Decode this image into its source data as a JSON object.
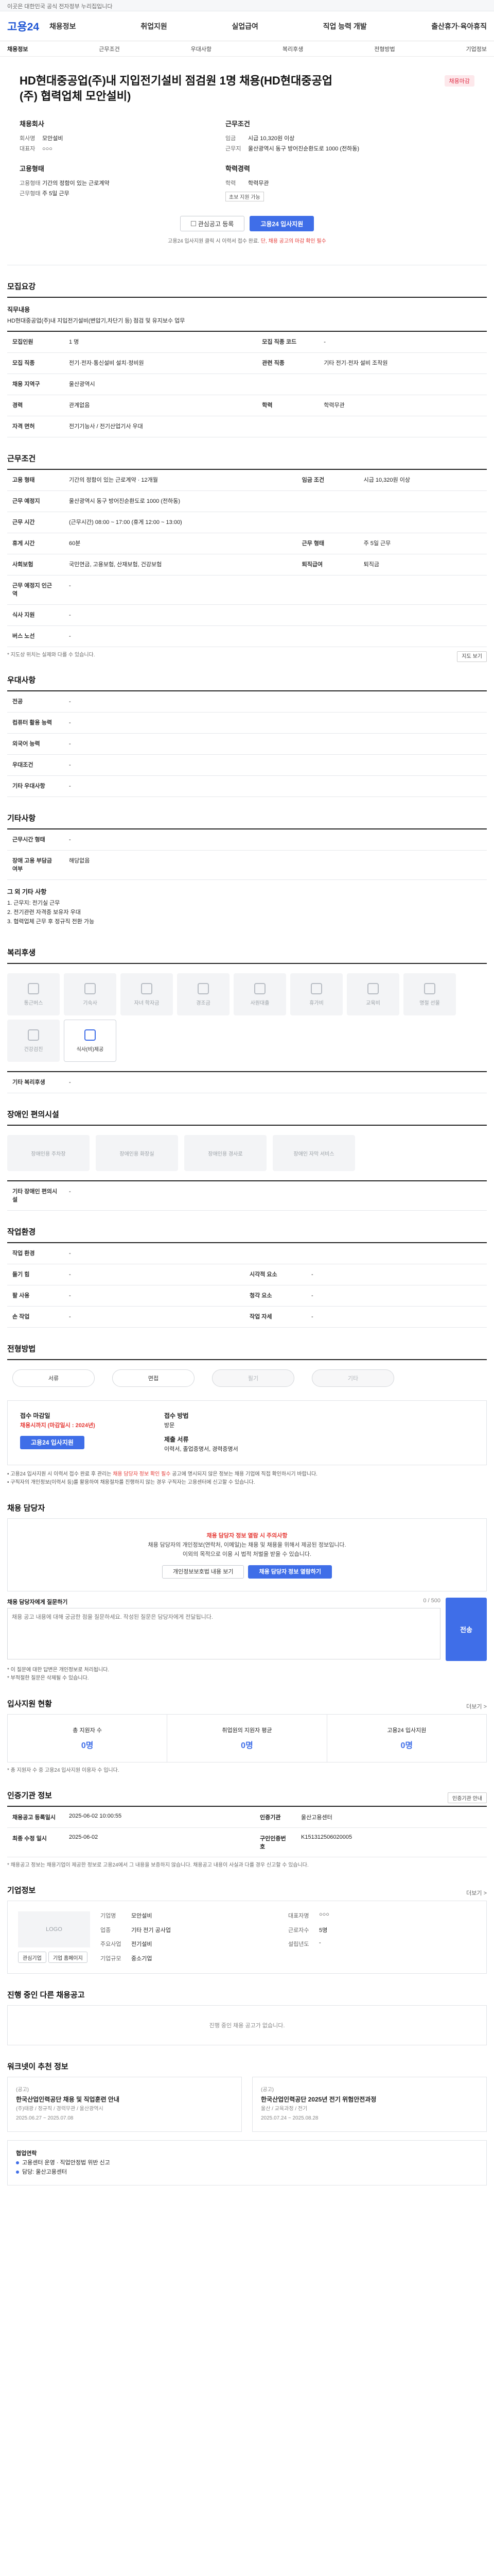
{
  "topbar": {
    "text": "이곳은 대한민국 공식 전자정부 누리집입니다"
  },
  "header": {
    "logo": "고용24",
    "nav": [
      "채용정보",
      "취업지원",
      "실업급여",
      "직업 능력 개발",
      "출산휴가·육아휴직"
    ]
  },
  "subbar": {
    "left": "채용정보",
    "items": [
      "근무조건",
      "우대사항",
      "복리후생",
      "전형방법",
      "기업정보"
    ]
  },
  "hero": {
    "badge": "채용마감",
    "title": "HD현대중공업(주)내 지입전기설비 점검원 1명 채용(HD현대중공업(주) 협력업체 모안설비)",
    "company_heading": "채용회사",
    "company_name_label": "회사명",
    "company_name": "모안설비",
    "company_ceo_label": "대표자",
    "company_ceo": "○○○",
    "cond_heading": "근무조건",
    "wage_label": "임금",
    "wage": "시급 10,320원 이상",
    "place_label": "근무지",
    "place": "울산광역시 동구 방어진순환도로 1000 (전하동)",
    "form_heading": "고용형태",
    "form_label": "고용형태",
    "form": "기간의 정함이 있는 근로계약",
    "career_label": "근무형태",
    "career": "주 5일 근무",
    "edu_heading": "학력경력",
    "edu_label": "학력",
    "edu": "학력무관",
    "tags": [
      "초보 지원 가능"
    ],
    "btn_interest": "관심공고 등록",
    "btn_apply": "고용24 입사지원",
    "hint_prefix": "고용24 입사지원 클릭 시 이력서 접수 완료. ",
    "hint_red": "단, 채용 공고의 마감 확인 필수"
  },
  "job": {
    "title": "모집요강",
    "desc_head": "직무내용",
    "desc": "HD현대중공업(주)내 지입전기설비(변압기,차단기 등) 점검 및 유지보수 업무",
    "rows": [
      {
        "k": "모집인원",
        "v": "1 명",
        "k2": "모집 직종 코드",
        "v2": "-"
      },
      {
        "k": "모집 직종",
        "v": "전기·전자·통신설비 설치·정비원",
        "k2": "관련 직종",
        "v2": "기타 전기·전자 설비 조작원"
      },
      {
        "k": "채용 지역구",
        "v": "울산광역시",
        "k2": "",
        "v2": ""
      },
      {
        "k": "경력",
        "v": "관계없음",
        "k2": "학력",
        "v2": "학력무관"
      },
      {
        "k": "자격 면허",
        "v": "전기기능사 / 전기산업기사 우대",
        "k2": "",
        "v2": ""
      }
    ]
  },
  "work": {
    "title": "근무조건",
    "rows": [
      {
        "k": "고용 형태",
        "v": "기간의 정함이 있는 근로계약 · 12개월",
        "k2": "임금 조건",
        "v2": "시급 10,320원 이상"
      },
      {
        "k": "근무 예정지",
        "v": "울산광역시 동구 방어진순환도로 1000 (전하동)",
        "k2": "",
        "v2": ""
      },
      {
        "k": "근무 시간",
        "v": "(근무시간) 08:00 ~ 17:00 (휴게 12:00 ~ 13:00)",
        "k2": "",
        "v2": ""
      },
      {
        "k": "휴게 시간",
        "v": "60분",
        "k2": "근무 형태",
        "v2": "주 5일 근무"
      },
      {
        "k": "사회보험",
        "v": "국민연금, 고용보험, 산재보험, 건강보험",
        "k2": "퇴직급여",
        "v2": "퇴직금"
      },
      {
        "k": "근무 예정지 인근 역",
        "v": "-",
        "k2": "",
        "v2": ""
      },
      {
        "k": "식사 지원",
        "v": "-",
        "k2": "",
        "v2": ""
      },
      {
        "k": "버스 노선",
        "v": "-",
        "k2": "",
        "v2": ""
      }
    ],
    "mapbtn": "지도 보기",
    "note": "* 지도상 위치는 실제와 다를 수 있습니다."
  },
  "pref": {
    "title": "우대사항",
    "rows": [
      {
        "k": "전공",
        "v": "-"
      },
      {
        "k": "컴퓨터 활용 능력",
        "v": "-"
      },
      {
        "k": "외국어 능력",
        "v": "-"
      },
      {
        "k": "우대조건",
        "v": "-"
      },
      {
        "k": "기타 우대사항",
        "v": "-"
      }
    ]
  },
  "etc": {
    "title": "기타사항",
    "rows": [
      {
        "k": "근무시간 형태",
        "v": "-"
      },
      {
        "k": "장애 고용 부담금 여부",
        "v": "해당없음"
      }
    ],
    "desc_head": "그 외 기타 사항",
    "desc_lines": [
      "1. 근무지: 전기실 근무",
      "2. 전기관련 자격증 보유자 우대",
      "3. 협력업체 근무 후 정규직 전환 가능"
    ]
  },
  "welfare": {
    "title": "복리후생",
    "items": [
      {
        "label": "통근버스",
        "on": false
      },
      {
        "label": "기숙사",
        "on": false
      },
      {
        "label": "자녀 학자금",
        "on": false
      },
      {
        "label": "경조금",
        "on": false
      },
      {
        "label": "사원대출",
        "on": false
      },
      {
        "label": "휴가비",
        "on": false
      },
      {
        "label": "교육비",
        "on": false
      },
      {
        "label": "명절 선물",
        "on": false
      },
      {
        "label": "건강검진",
        "on": false
      },
      {
        "label": "식사(비)제공",
        "on": true
      }
    ],
    "other_k": "기타 복리후생",
    "other_v": "-"
  },
  "disabled": {
    "title": "장애인 편의시설",
    "items": [
      "장애인용 주차장",
      "장애인용 화장실",
      "장애인용 경사로",
      "장애인 자막 서비스"
    ],
    "other_k": "기타 장애인 편의시설",
    "other_v": "-"
  },
  "env": {
    "title": "작업환경",
    "rows": [
      {
        "k": "작업 환경",
        "v": "-",
        "k2": "",
        "v2": ""
      },
      {
        "k": "들기 힘",
        "v": "-",
        "k2": "시각적 요소",
        "v2": "-"
      },
      {
        "k": "팔 사용",
        "v": "-",
        "k2": "청각 요소",
        "v2": "-"
      },
      {
        "k": "손 작업",
        "v": "-",
        "k2": "작업 자세",
        "v2": "-"
      }
    ]
  },
  "process": {
    "title": "전형방법",
    "steps": [
      {
        "t": "서류",
        "off": false
      },
      {
        "t": "면접",
        "off": false
      },
      {
        "t": "필기",
        "off": true
      },
      {
        "t": "기타",
        "off": true
      }
    ]
  },
  "applyinfo": {
    "col1_head": "접수 마감일",
    "col1_red": "채용시까지 (마감일시 : 2024년)",
    "col1_btn": "고용24 입사지원",
    "col2_head": "접수 방법",
    "col2_v": "방문",
    "col2_head2": "제출 서류",
    "col2_v2": "이력서, 졸업증명서, 경력증명서",
    "warn1": "고용24 입사지원 시 이력서 접수 완료 후 관리는 ",
    "warn_red": "채용 담당자 정보 확인 필수",
    "warn2": " 공고에 명시되지 않은 정보는 채용 기업에 직접 확인하시기 바랍니다.",
    "warn3": "구직자의 개인정보(이력서 등)를 활용하여 채용절차를 진행하지 않는 경우 구직자는 고용센터에 신고할 수 있습니다."
  },
  "contact": {
    "title": "채용 담당자",
    "box_red": "채용 담당자 정보 열람 시 주의사항",
    "box_text1": "채용 담당자의 개인정보(연락처, 이메일)는 채용 및 채용을 위해서 제공된 정보입니다.",
    "box_text2": "이외의 목적으로 이용 시 법적 처벌을 받을 수 있습니다.",
    "btn1": "개인정보보호법 내용 보기",
    "btn2": "채용 담당자 정보 열람하기",
    "qna_head": "채용 담당자에게 질문하기",
    "qna_limit": "0 / 500",
    "qna_placeholder": "채용 공고 내용에 대해 궁금한 점을 질문하세요. 작성된 질문은 담당자에게 전달됩니다.",
    "qna_btn": "전송",
    "qna_notes": [
      "* 이 질문에 대한 답변은 개인정보로 처리됩니다.",
      "* 부적절한 질문은 삭제될 수 있습니다."
    ]
  },
  "stats": {
    "title": "입사지원 현황",
    "more": "더보기 >",
    "items": [
      {
        "k": "총 지원자 수",
        "v": "0명"
      },
      {
        "k": "취업원의 지원자 평균",
        "v": "0명"
      },
      {
        "k": "고용24 입사지원",
        "v": "0명"
      }
    ],
    "note": "* 총 지원자 수 중 고용24 입사지원 이용자 수 입니다."
  },
  "cert": {
    "title": "인증기관 정보",
    "btn": "인증기관 안내",
    "rows": [
      {
        "k": "채용공고 등록일시",
        "v": "2025-06-02 10:00:55",
        "k2": "인증기관",
        "v2": "울산고용센터"
      },
      {
        "k": "최종 수정 일시",
        "v": "2025-06-02",
        "k2": "구인인증번호",
        "v2": "K151312506020005"
      }
    ],
    "note": "* 채용공고 정보는 채용기업이 제공한 정보로 고용24에서 그 내용을 보증하지 않습니다. 채용공고 내용이 사실과 다를 경우 신고할 수 있습니다."
  },
  "company": {
    "title": "기업정보",
    "more": "더보기 >",
    "logo": "LOGO",
    "btn1": "관심기업",
    "btn2": "기업 홈페이지",
    "rows": [
      {
        "k": "기업명",
        "v": "모안설비",
        "k2": "대표자명",
        "v2": "○○○"
      },
      {
        "k": "업종",
        "v": "기타 전기 공사업",
        "k2": "근로자수",
        "v2": "5명"
      },
      {
        "k": "주요사업",
        "v": "전기설비",
        "k2": "설립년도",
        "v2": "-"
      },
      {
        "k": "기업규모",
        "v": "중소기업",
        "k2": "",
        "v2": ""
      }
    ]
  },
  "others": {
    "title": "진행 중인 다른 채용공고",
    "empty": "진행 중인 채용 공고가 없습니다."
  },
  "news": {
    "title": "워크넷이 추천 정보",
    "cards": [
      {
        "label": "(공고)",
        "t": "한국산업인력공단 채용 및 직업훈련 안내",
        "meta": "(주)태광 / 정규직 / 경력무관 / 울산광역시",
        "date": "2025.06.27 ~ 2025.07.08"
      },
      {
        "label": "(공고)",
        "t": "한국산업인력공단 2025년 전기 위험안전과정",
        "meta": "울산 / 교육과정 / 전기",
        "date": "2025.07.24 ~ 2025.08.28"
      }
    ],
    "info_title": "협업연락",
    "info_lines": [
      "고용센터 운영 · 직업안정법 위반 신고",
      "담당: 울산고용센터"
    ]
  }
}
